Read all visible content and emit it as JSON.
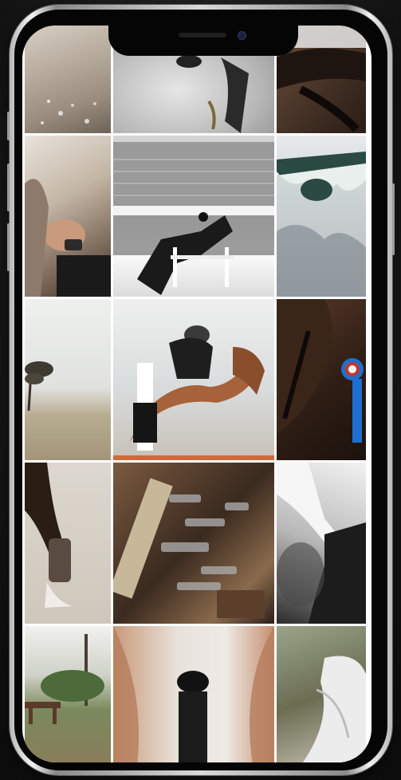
{
  "feed": {
    "tiles": [
      {
        "icon": "photo-icon"
      },
      {
        "icon": "photo-icon"
      },
      {
        "icon": "photo-icon"
      },
      {
        "icon": "photo-icon"
      },
      {
        "icon": "photo-icon"
      },
      {
        "icon": "photo-icon"
      },
      {
        "icon": "photo-icon"
      },
      {
        "icon": "photo-icon"
      },
      {
        "icon": "photo-icon"
      },
      {
        "icon": "photo-icon"
      },
      {
        "icon": "photo-icon"
      },
      {
        "icon": "photo-icon"
      },
      {
        "icon": "photo-icon"
      },
      {
        "icon": "photo-icon"
      },
      {
        "icon": "photo-icon"
      }
    ]
  },
  "colors": {
    "frame": "#d9d9d9",
    "bezel": "#050505",
    "background": "#1c1c1c",
    "ribbon_blue": "#1e6fd0",
    "ribbon_red": "#c0392b"
  }
}
